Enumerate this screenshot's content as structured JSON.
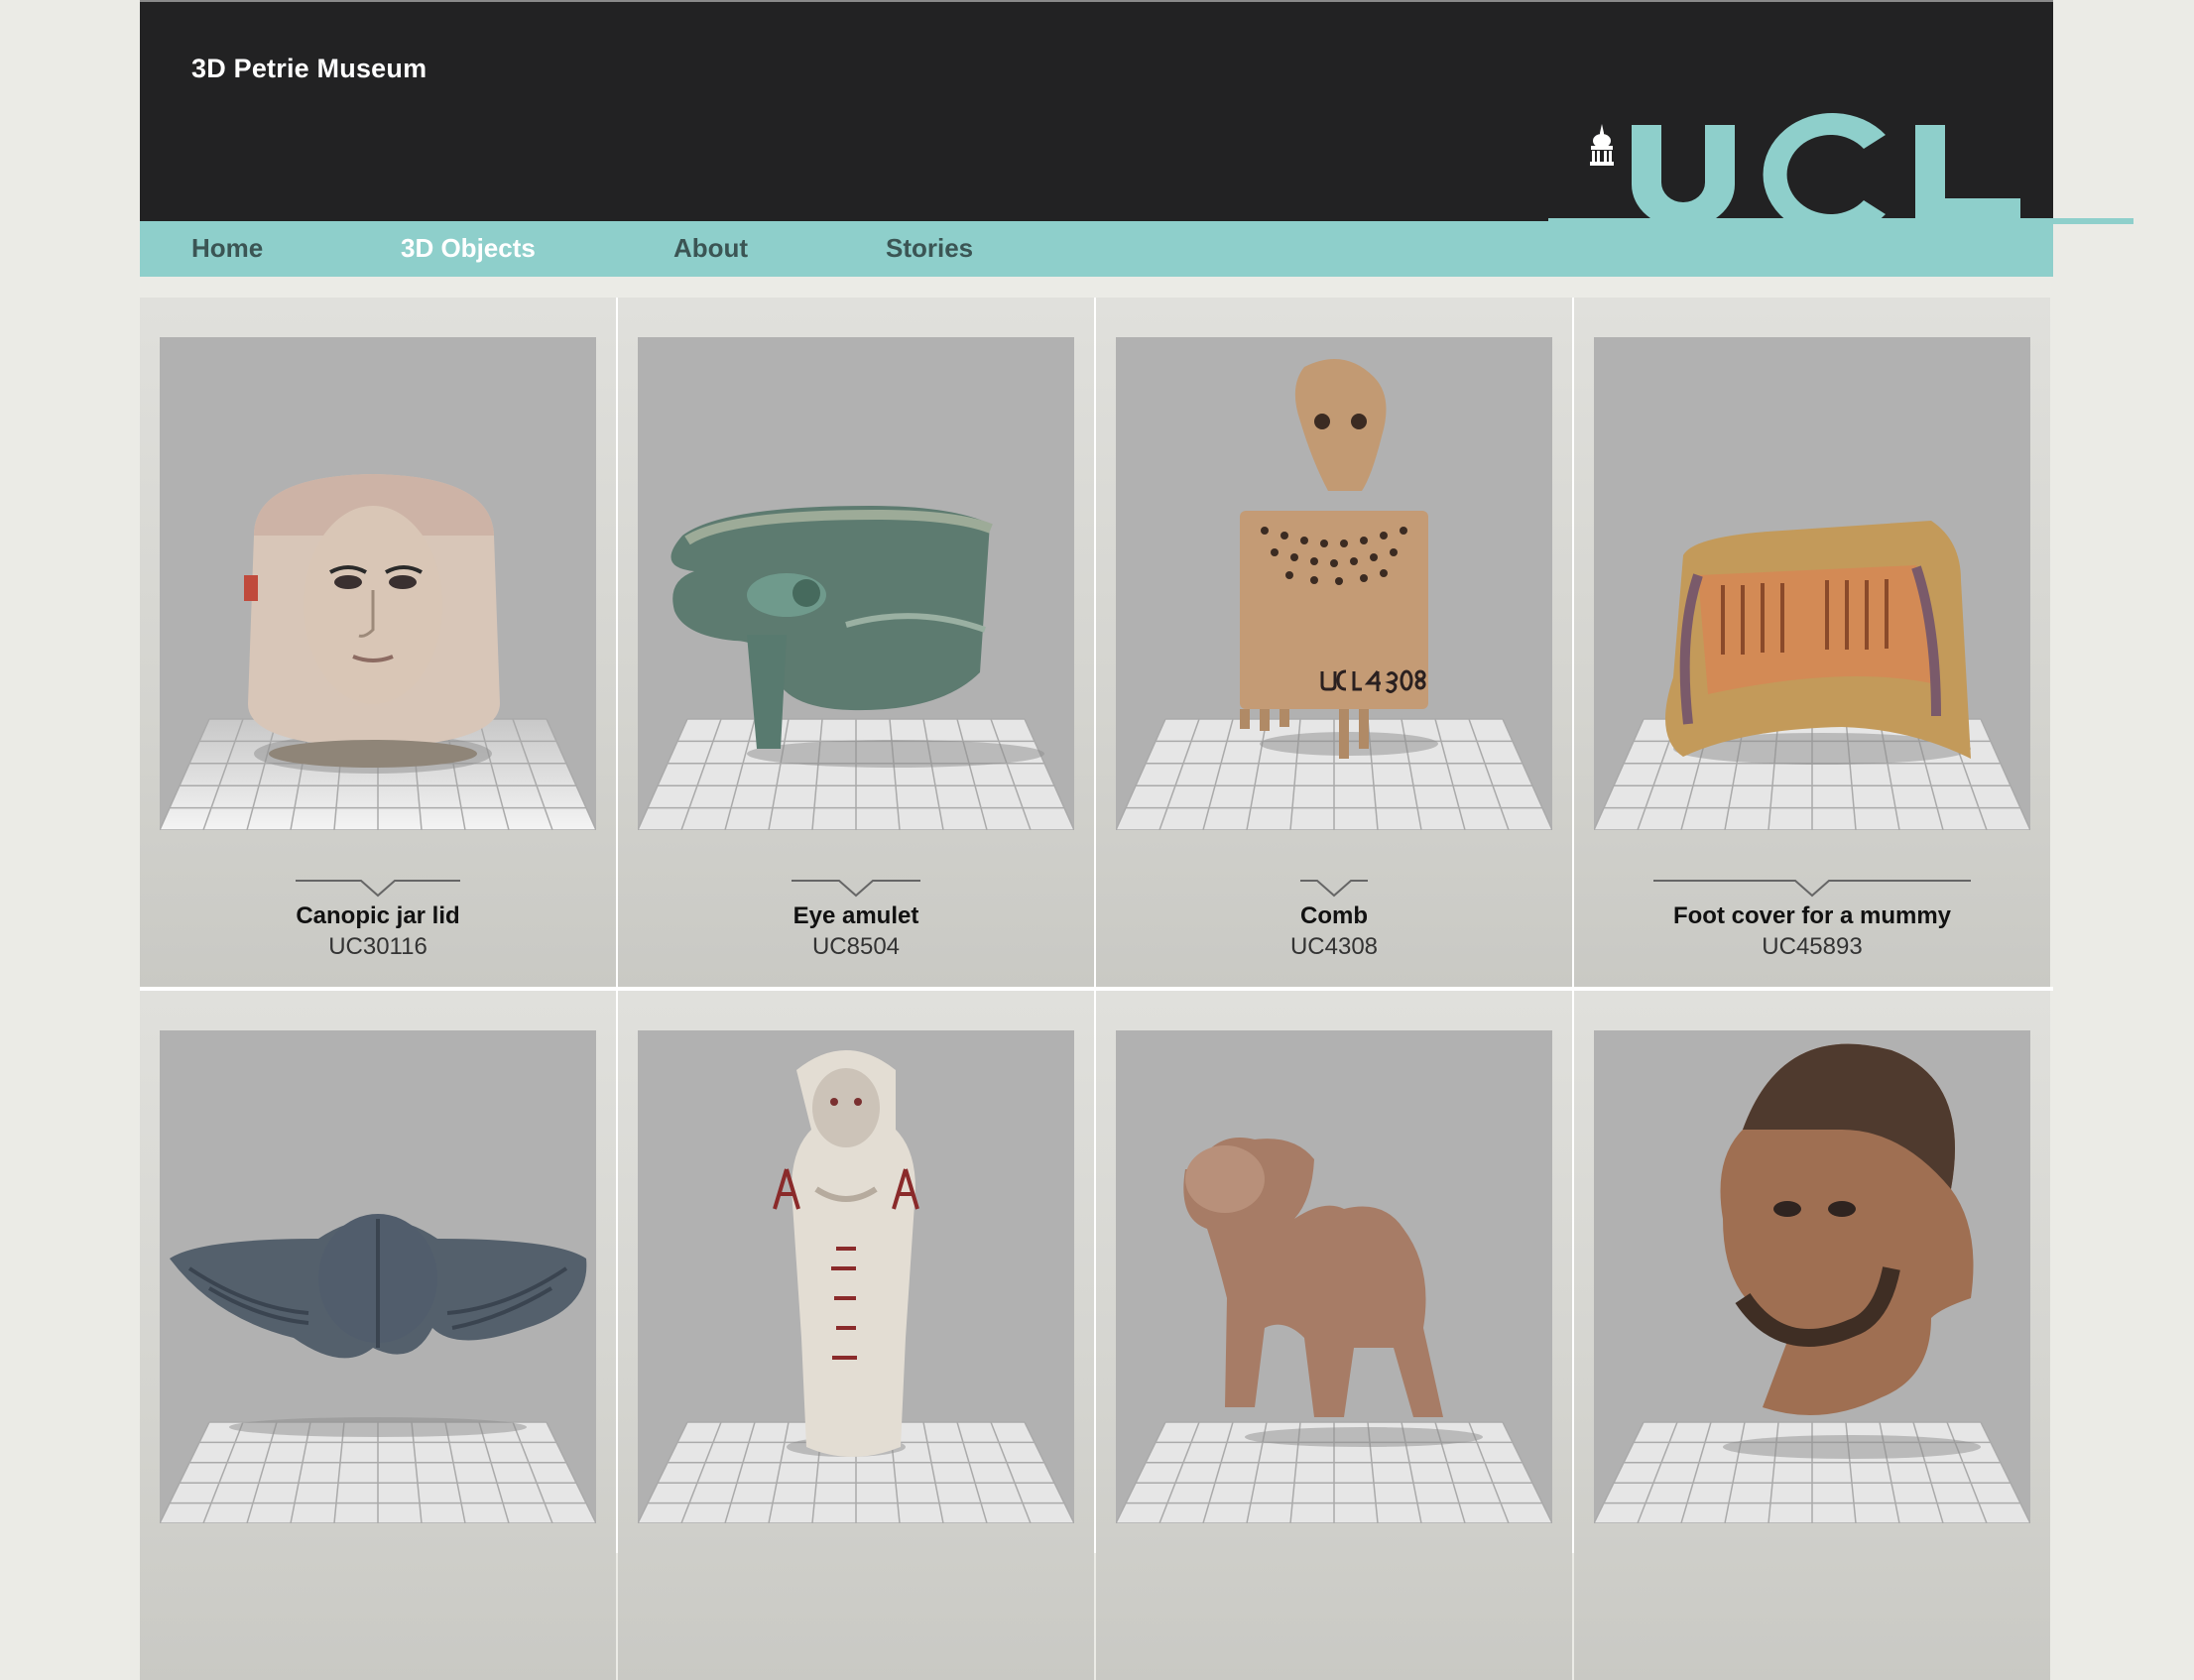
{
  "site": {
    "title": "3D Petrie Museum",
    "logo_text": "UCL"
  },
  "nav": {
    "items": [
      {
        "label": "Home",
        "active": false
      },
      {
        "label": "3D Objects",
        "active": true
      },
      {
        "label": "About",
        "active": false
      },
      {
        "label": "Stories",
        "active": false
      }
    ]
  },
  "objects": [
    {
      "title": "Canopic jar lid",
      "accession": "UC30116"
    },
    {
      "title": "Eye amulet",
      "accession": "UC8504"
    },
    {
      "title": "Comb",
      "accession": "UC4308"
    },
    {
      "title": "Foot cover for a mummy",
      "accession": "UC45893"
    },
    {
      "title": "",
      "accession": ""
    },
    {
      "title": "",
      "accession": ""
    },
    {
      "title": "",
      "accession": ""
    },
    {
      "title": "",
      "accession": ""
    }
  ],
  "object_images": [
    "canopic-jar-lid-icon",
    "eye-amulet-icon",
    "comb-icon",
    "foot-cover-icon",
    "winged-scarab-icon",
    "shabti-figure-icon",
    "camel-figure-icon",
    "bearded-head-icon"
  ],
  "colors": {
    "header": "#222223",
    "nav": "#8ecfcb",
    "nav_active": "#ffffff",
    "nav_text": "#3b5554",
    "thumb_bg": "#b1b1b1"
  },
  "comb_inscription": "UC4308"
}
